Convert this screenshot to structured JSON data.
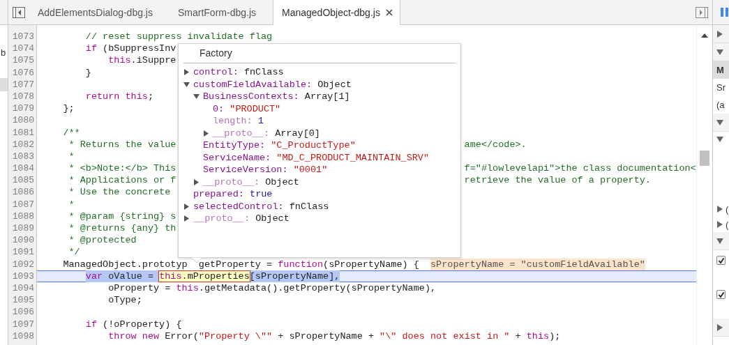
{
  "left_panel": {
    "items": [
      {
        "text": "b",
        "selected": false
      },
      {
        "selected": true
      }
    ]
  },
  "tabs": [
    {
      "label": "AddElementsDialog-dbg.js",
      "selected": false
    },
    {
      "label": "SmartForm-dbg.js",
      "selected": false
    },
    {
      "label": "ManagedObject-dbg.js",
      "selected": true
    }
  ],
  "editor": {
    "lines": [
      {
        "number": "1073",
        "kind": "block",
        "current": false,
        "code": [
          {
            "text": "// reset suppress invalidate flag",
            "kind": "comment"
          }
        ]
      },
      {
        "number": "1074",
        "kind": "block",
        "current": false,
        "code": [
          {
            "text": "if",
            "kind": "keyword"
          },
          {
            "text": " (bSuppressInv",
            "kind": "plain"
          }
        ]
      },
      {
        "number": "1075",
        "kind": "inner",
        "current": false,
        "code": [
          {
            "text": "this",
            "kind": "keyword"
          },
          {
            "text": ".iSuppre",
            "kind": "plain"
          }
        ]
      },
      {
        "number": "1076",
        "kind": "block",
        "current": false,
        "code": [
          {
            "text": "}",
            "kind": "plain"
          }
        ]
      },
      {
        "number": "1077",
        "kind": "blank",
        "current": false
      },
      {
        "number": "1078",
        "kind": "block",
        "current": false,
        "code": [
          {
            "text": "return",
            "kind": "keyword"
          },
          {
            "text": " this",
            "kind": "keyword"
          },
          {
            "text": ";",
            "kind": "plain"
          }
        ]
      },
      {
        "number": "1079",
        "kind": "outer",
        "current": false,
        "code": [
          {
            "text": "};",
            "kind": "plain"
          }
        ]
      },
      {
        "number": "1080",
        "kind": "blank",
        "current": false
      },
      {
        "number": "1081",
        "kind": "outer",
        "current": false,
        "code": [
          {
            "text": "/**",
            "kind": "comment"
          }
        ]
      },
      {
        "number": "1082",
        "kind": "doc",
        "current": false,
        "code": [
          {
            "text": "* Returns the value",
            "kind": "comment"
          }
        ],
        "tail": {
          "kind": "popup",
          "tokens": [
            {
              "text": "ame</code>.",
              "kind": "comment"
            }
          ]
        }
      },
      {
        "number": "1083",
        "kind": "doc",
        "current": false,
        "code": [
          {
            "text": "*",
            "kind": "comment"
          }
        ]
      },
      {
        "number": "1084",
        "kind": "doc",
        "current": false,
        "code": [
          {
            "text": "* <b>Note:</b> This",
            "kind": "comment"
          }
        ],
        "tail": {
          "kind": "popup",
          "tokens": [
            {
              "text": "f=\"#lowlevelapi\">the class documentation<",
              "kind": "comment"
            }
          ]
        }
      },
      {
        "number": "1085",
        "kind": "doc",
        "current": false,
        "code": [
          {
            "text": "* Applications or f",
            "kind": "comment"
          }
        ],
        "tail": {
          "kind": "popup",
          "tokens": [
            {
              "text": "retrieve the value of a property.",
              "kind": "comment"
            }
          ]
        }
      },
      {
        "number": "1086",
        "kind": "doc",
        "current": false,
        "code": [
          {
            "text": "* Use the concrete",
            "kind": "comment"
          }
        ]
      },
      {
        "number": "1087",
        "kind": "doc",
        "current": false,
        "code": [
          {
            "text": "*",
            "kind": "comment"
          }
        ]
      },
      {
        "number": "1088",
        "kind": "doc",
        "current": false,
        "code": [
          {
            "text": "* @param {string} s",
            "kind": "comment"
          }
        ]
      },
      {
        "number": "1089",
        "kind": "doc",
        "current": false,
        "code": [
          {
            "text": "* @returns {any} th",
            "kind": "comment"
          }
        ]
      },
      {
        "number": "1090",
        "kind": "doc",
        "current": false,
        "code": [
          {
            "text": "* @protected",
            "kind": "comment"
          }
        ]
      },
      {
        "number": "1091",
        "kind": "doc",
        "current": false,
        "code": [
          {
            "text": "*/",
            "kind": "comment"
          }
        ]
      },
      {
        "number": "1092",
        "kind": "outer",
        "current": false,
        "code": [
          {
            "text": "ManagedObject.prototyp",
            "kind": "plain"
          }
        ],
        "tail": {
          "kind": "pointer",
          "tokens": [
            {
              "text": "getProperty = ",
              "kind": "plain"
            },
            {
              "text": "function",
              "kind": "keyword"
            },
            {
              "text": "(sPropertyName) {",
              "kind": "plain"
            }
          ]
        },
        "annotation": "sPropertyName = \"customFieldAvailable\""
      },
      {
        "number": "1093",
        "kind": "block",
        "current": true,
        "code": [
          {
            "text": "var",
            "kind": "keyword"
          },
          {
            "text": " oValue = ",
            "kind": "plain"
          },
          {
            "kind": "hover",
            "tokens": [
              {
                "text": "this",
                "kind": "keyword"
              },
              {
                "text": ".mProperties",
                "kind": "plain"
              }
            ]
          },
          {
            "text": "[sPropertyName],",
            "kind": "plain"
          }
        ]
      },
      {
        "number": "1094",
        "kind": "inner",
        "current": false,
        "code": [
          {
            "text": "oProperty = ",
            "kind": "plain"
          },
          {
            "text": "this",
            "kind": "keyword"
          },
          {
            "text": ".getMetadata().getProperty(sPropertyName),",
            "kind": "plain"
          }
        ]
      },
      {
        "number": "1095",
        "kind": "inner",
        "current": false,
        "code": [
          {
            "text": "oType;",
            "kind": "plain"
          }
        ]
      },
      {
        "number": "1096",
        "kind": "blank",
        "current": false
      },
      {
        "number": "1097",
        "kind": "block",
        "current": false,
        "code": [
          {
            "text": "if",
            "kind": "keyword"
          },
          {
            "text": " (!oProperty) {",
            "kind": "plain"
          }
        ]
      },
      {
        "number": "1098",
        "kind": "inner",
        "current": false,
        "code": [
          {
            "text": "throw",
            "kind": "keyword"
          },
          {
            "text": " new",
            "kind": "keyword"
          },
          {
            "text": " Error(",
            "kind": "plain"
          },
          {
            "text": "\"Property \\\"\"",
            "kind": "string"
          },
          {
            "text": " + sPropertyName + ",
            "kind": "plain"
          },
          {
            "text": "\"\\\" does not exist in \"",
            "kind": "string"
          },
          {
            "text": " + ",
            "kind": "plain"
          },
          {
            "text": "this",
            "kind": "keyword"
          },
          {
            "text": ");",
            "kind": "plain"
          }
        ]
      }
    ]
  },
  "popover": {
    "title": "Factory",
    "items": [
      {
        "kind": "node",
        "expanded": false,
        "key": "control:",
        "value": {
          "text": "fnClass",
          "kind": "object"
        },
        "dimmed": false
      },
      {
        "kind": "node",
        "expanded": true,
        "key": "customFieldAvailable:",
        "value": {
          "text": "Object",
          "kind": "object"
        },
        "dimmed": false,
        "children": [
          {
            "kind": "node",
            "expanded": true,
            "key": "BusinessContexts:",
            "value": {
              "text": "Array[1]",
              "kind": "object"
            },
            "dimmed": false,
            "children": [
              {
                "kind": "leaf",
                "key": "0:",
                "value": {
                  "text": "\"PRODUCT\"",
                  "kind": "string"
                },
                "dimmed": false
              },
              {
                "kind": "leaf",
                "key": "length:",
                "value": {
                  "text": "1",
                  "kind": "number"
                },
                "dimmed": true
              },
              {
                "kind": "node",
                "expanded": false,
                "key": "__proto__:",
                "value": {
                  "text": "Array[0]",
                  "kind": "object"
                },
                "dimmed": true
              }
            ]
          },
          {
            "kind": "leaf",
            "key": "EntityType:",
            "value": {
              "text": "\"C_ProductType\"",
              "kind": "string"
            },
            "dimmed": false
          },
          {
            "kind": "leaf",
            "key": "ServiceName:",
            "value": {
              "text": "\"MD_C_PRODUCT_MAINTAIN_SRV\"",
              "kind": "string"
            },
            "dimmed": false
          },
          {
            "kind": "leaf",
            "key": "ServiceVersion:",
            "value": {
              "text": "\"0001\"",
              "kind": "string"
            },
            "dimmed": false
          },
          {
            "kind": "node",
            "expanded": false,
            "key": "__proto__:",
            "value": {
              "text": "Object",
              "kind": "object"
            },
            "dimmed": true
          }
        ]
      },
      {
        "kind": "leaf",
        "key": "prepared:",
        "value": {
          "text": "true",
          "kind": "number"
        },
        "dimmed": false
      },
      {
        "kind": "node",
        "expanded": false,
        "key": "selectedControl:",
        "value": {
          "text": "fnClass",
          "kind": "object"
        },
        "dimmed": false
      },
      {
        "kind": "node",
        "expanded": false,
        "key": "__proto__:",
        "value": {
          "text": "Object",
          "kind": "object"
        },
        "dimmed": true
      }
    ]
  },
  "right_panel": {
    "rows": [
      {
        "kind": "section",
        "expanded": false
      },
      {
        "kind": "section",
        "expanded": true
      },
      {
        "kind": "item",
        "text": "M",
        "selected": true
      },
      {
        "kind": "item",
        "text": "Sr",
        "selected": false
      },
      {
        "kind": "item",
        "text": "(a",
        "selected": false
      },
      {
        "kind": "section",
        "expanded": true
      },
      {
        "kind": "node",
        "expanded": true
      },
      {
        "kind": "node",
        "expanded": false,
        "text": "("
      },
      {
        "kind": "node",
        "expanded": false,
        "text": "("
      },
      {
        "kind": "section",
        "expanded": true
      },
      {
        "kind": "checkbox",
        "checked": true
      },
      {
        "kind": "checkbox",
        "checked": true
      },
      {
        "kind": "section",
        "expanded": false
      }
    ]
  }
}
